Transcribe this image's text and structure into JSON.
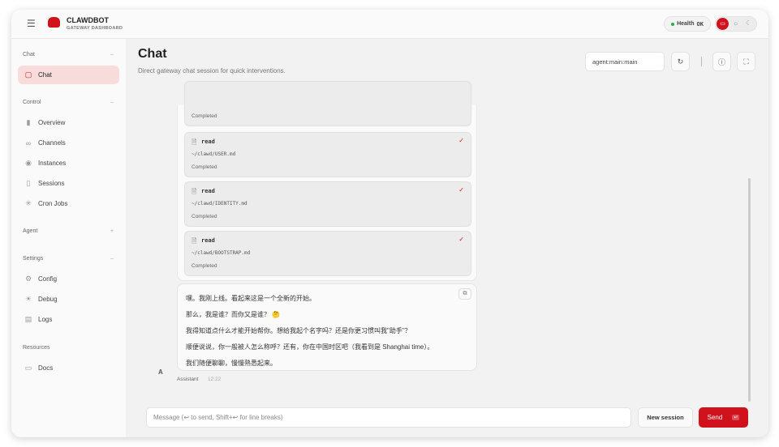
{
  "header": {
    "brand": "CLAWDBOT",
    "subtitle": "GATEWAY DASHBOARD",
    "health_label": "Health",
    "health_value": "OK"
  },
  "sidebar": {
    "sections": [
      {
        "label": "Chat",
        "items": [
          {
            "label": "Chat",
            "icon": "message-icon",
            "active": true
          }
        ]
      },
      {
        "label": "Control",
        "items": [
          {
            "label": "Overview",
            "icon": "bar-chart-icon"
          },
          {
            "label": "Channels",
            "icon": "link-icon"
          },
          {
            "label": "Instances",
            "icon": "radio-icon"
          },
          {
            "label": "Sessions",
            "icon": "file-icon"
          },
          {
            "label": "Cron Jobs",
            "icon": "loader-icon"
          }
        ]
      },
      {
        "label": "Agent",
        "items": []
      },
      {
        "label": "Settings",
        "items": [
          {
            "label": "Config",
            "icon": "gear-icon"
          },
          {
            "label": "Debug",
            "icon": "bug-icon"
          },
          {
            "label": "Logs",
            "icon": "scroll-icon"
          }
        ]
      },
      {
        "label": "Resources",
        "items": [
          {
            "label": "Docs",
            "icon": "book-icon"
          }
        ]
      }
    ]
  },
  "page": {
    "title": "Chat",
    "subtitle": "Direct gateway chat session for quick interventions.",
    "session_key": "agent:main:main"
  },
  "tools": [
    {
      "name": "",
      "path": "",
      "status": "Completed"
    },
    {
      "name": "read",
      "path": "~/clawd/USER.md",
      "status": "Completed"
    },
    {
      "name": "read",
      "path": "~/clawd/IDENTITY.md",
      "status": "Completed"
    },
    {
      "name": "read",
      "path": "~/clawd/BOOTSTRAP.md",
      "status": "Completed"
    }
  ],
  "message": {
    "avatar": "A",
    "sender": "Assistant",
    "time": "12:22",
    "lines": [
      "嘿。我刚上线。看起来这是一个全新的开始。",
      "那么，我是谁？而你又是谁？ 🤔",
      "我得知道点什么才能开始帮你。想给我起个名字吗？还是你更习惯叫我\"助手\"？",
      "顺便说说，你一般被人怎么称呼？还有，你在中国时区吧（我看到是 Shanghai time）。",
      "我们随便聊聊，慢慢熟悉起来。"
    ]
  },
  "composer": {
    "placeholder": "Message (↩ to send, Shift+↩ for line breaks)",
    "new_session": "New session",
    "send": "Send",
    "send_key": "↵"
  },
  "colors": {
    "accent": "#d0121c",
    "active_bg": "#f8dcdc",
    "ok": "#22b14c"
  }
}
